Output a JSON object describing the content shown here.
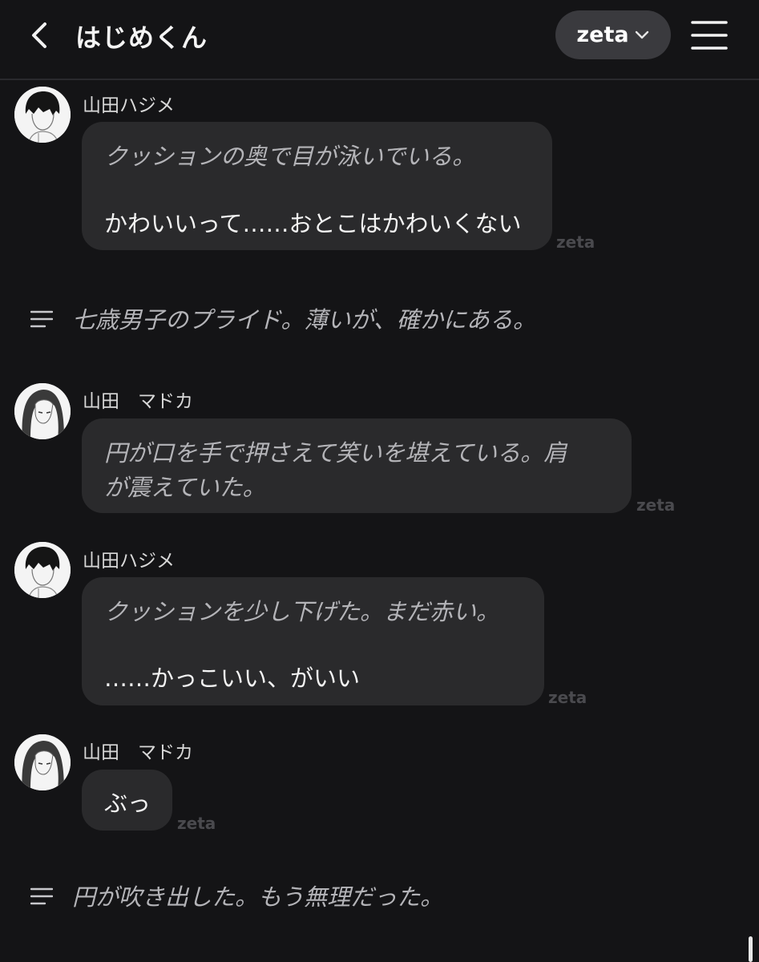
{
  "header": {
    "back_icon": "chevron-left-icon",
    "title": "はじめくん",
    "model_label": "zeta",
    "model_dropdown_icon": "chevron-down-icon",
    "menu_icon": "hamburger-menu-icon"
  },
  "messages": [
    {
      "sender": "山田ハジメ",
      "avatar": "avatar-boy",
      "lines": [
        {
          "text": "クッションの奥で目が泳いでいる。",
          "style": "action"
        },
        {
          "text": "",
          "style": "blank"
        },
        {
          "text": "かわいいって……おとこはかわいくない",
          "style": "speech"
        }
      ],
      "tag": "zeta"
    },
    {
      "type": "narration",
      "icon": "narration-lines-icon",
      "text": "七歳男子のプライド。薄いが、確かにある。"
    },
    {
      "sender": "山田　マドカ",
      "avatar": "avatar-girl",
      "lines": [
        {
          "text": "円が口を手で押さえて笑いを堪えている。肩",
          "style": "action"
        },
        {
          "text": "が震えていた。",
          "style": "action"
        }
      ],
      "tag": "zeta"
    },
    {
      "sender": "山田ハジメ",
      "avatar": "avatar-boy",
      "lines": [
        {
          "text": "クッションを少し下げた。まだ赤い。",
          "style": "action"
        },
        {
          "text": "",
          "style": "blank"
        },
        {
          "text": "……かっこいい、がいい",
          "style": "speech"
        }
      ],
      "tag": "zeta"
    },
    {
      "sender": "山田　マドカ",
      "avatar": "avatar-girl",
      "lines": [
        {
          "text": "ぶっ",
          "style": "speech"
        }
      ],
      "tag": "zeta"
    },
    {
      "type": "narration",
      "icon": "narration-lines-icon",
      "text": "円が吹き出した。もう無理だった。"
    }
  ]
}
